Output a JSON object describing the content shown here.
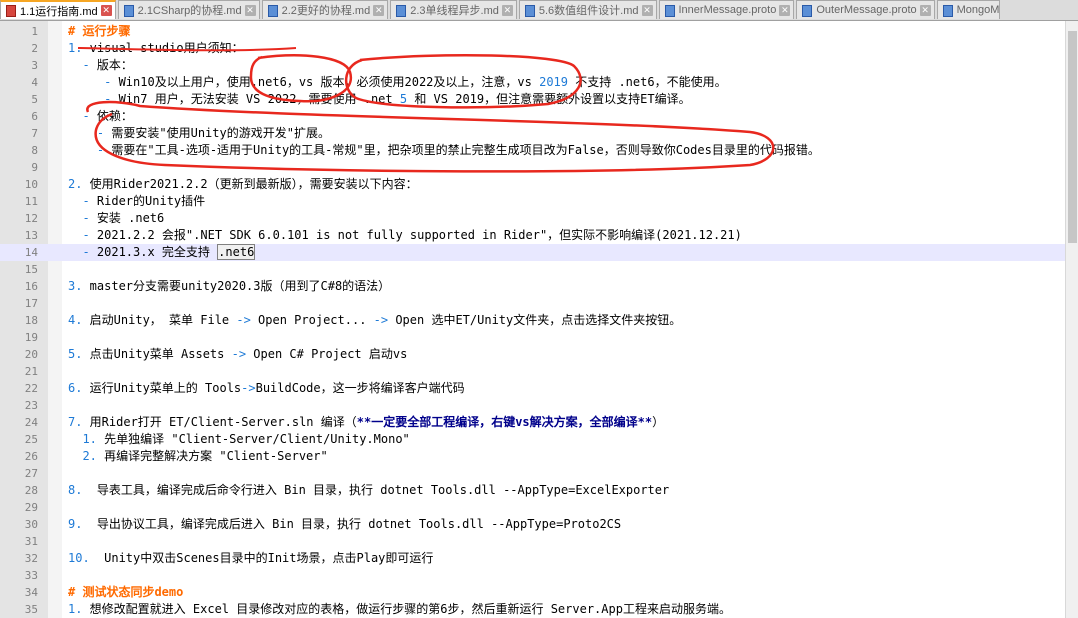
{
  "tabs": [
    {
      "label": "1.1运行指南.md",
      "active": true,
      "icon": "red"
    },
    {
      "label": "2.1CSharp的协程.md",
      "active": false,
      "icon": "red"
    },
    {
      "label": "2.2更好的协程.md",
      "active": false,
      "icon": "red"
    },
    {
      "label": "2.3单线程异步.md",
      "active": false,
      "icon": "red"
    },
    {
      "label": "5.6数值组件设计.md",
      "active": false,
      "icon": "red"
    },
    {
      "label": "InnerMessage.proto",
      "active": false,
      "icon": "red"
    },
    {
      "label": "OuterMessage.proto",
      "active": false,
      "icon": "red"
    },
    {
      "label": "MongoM",
      "active": false,
      "icon": "red"
    }
  ],
  "lines": [
    {
      "n": "1",
      "t": "# 运行步骤"
    },
    {
      "n": "2",
      "t": "1. visual studio用户须知："
    },
    {
      "n": "3",
      "t": "  - 版本："
    },
    {
      "n": "4",
      "t": "     - Win10及以上用户，使用.net6，vs 版本，必须使用2022及以上，注意，vs 2019 不支持 .net6，不能使用。"
    },
    {
      "n": "5",
      "t": "     - Win7 用户，无法安装 VS 2022，需要使用 .net 5 和 VS 2019，但注意需要额外设置以支持ET编译。"
    },
    {
      "n": "6",
      "t": "  - 依赖："
    },
    {
      "n": "7",
      "t": "    - 需要安装\"使用Unity的游戏开发\"扩展。"
    },
    {
      "n": "8",
      "t": "    - 需要在\"工具-选项-适用于Unity的工具-常规\"里，把杂项里的禁止完整生成项目改为False，否则导致你Codes目录里的代码报错。"
    },
    {
      "n": "9",
      "t": ""
    },
    {
      "n": "10",
      "t": "2. 使用Rider2021.2.2（更新到最新版），需要安装以下内容："
    },
    {
      "n": "11",
      "t": "  - Rider的Unity插件"
    },
    {
      "n": "12",
      "t": "  - 安装 .net6"
    },
    {
      "n": "13",
      "t": "  - 2021.2.2 会报\".NET SDK 6.0.101 is not fully supported in Rider\"，但实际不影响编译(2021.12.21)"
    },
    {
      "n": "14",
      "t": "  - 2021.3.x 完全支持 .net6"
    },
    {
      "n": "15",
      "t": ""
    },
    {
      "n": "16",
      "t": "3. master分支需要unity2020.3版（用到了C#8的语法）"
    },
    {
      "n": "17",
      "t": ""
    },
    {
      "n": "18",
      "t": "4. 启动Unity， 菜单 File -> Open Project... -> Open 选中ET/Unity文件夹，点击选择文件夹按钮。"
    },
    {
      "n": "19",
      "t": ""
    },
    {
      "n": "20",
      "t": "5. 点击Unity菜单 Assets -> Open C# Project 启动vs"
    },
    {
      "n": "21",
      "t": ""
    },
    {
      "n": "22",
      "t": "6. 运行Unity菜单上的 Tools->BuildCode，这一步将编译客户端代码"
    },
    {
      "n": "23",
      "t": ""
    },
    {
      "n": "24",
      "t": "7. 用Rider打开 ET/Client-Server.sln 编译（**一定要全部工程编译，右键vs解决方案，全部编译**）"
    },
    {
      "n": "25",
      "t": "  1. 先单独编译 \"Client-Server/Client/Unity.Mono\""
    },
    {
      "n": "26",
      "t": "  2. 再编译完整解决方案 \"Client-Server\""
    },
    {
      "n": "27",
      "t": ""
    },
    {
      "n": "28",
      "t": "8.  导表工具，编译完成后命令行进入 Bin 目录，执行 dotnet Tools.dll --AppType=ExcelExporter"
    },
    {
      "n": "29",
      "t": ""
    },
    {
      "n": "30",
      "t": "9.  导出协议工具，编译完成后进入 Bin 目录，执行 dotnet Tools.dll --AppType=Proto2CS"
    },
    {
      "n": "31",
      "t": ""
    },
    {
      "n": "32",
      "t": "10.  Unity中双击Scenes目录中的Init场景，点击Play即可运行"
    },
    {
      "n": "33",
      "t": ""
    },
    {
      "n": "34",
      "t": "# 测试状态同步demo"
    },
    {
      "n": "35",
      "t": "1. 想修改配置就进入 Excel 目录修改对应的表格，做运行步骤的第6步，然后重新运行 Server.App工程来启动服务端。"
    }
  ]
}
